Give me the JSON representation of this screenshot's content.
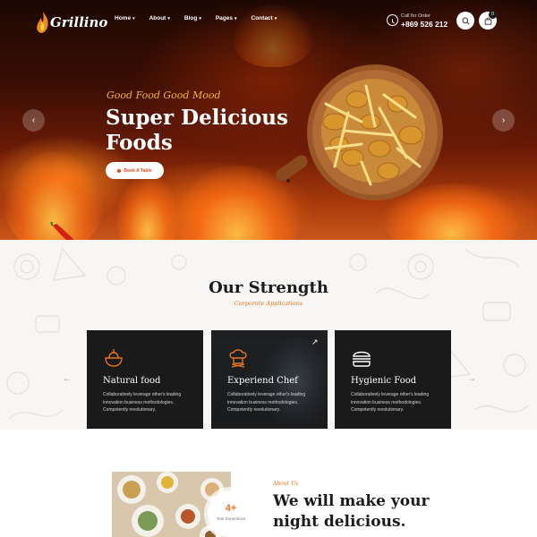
{
  "header": {
    "logo_text": "Grillino",
    "nav": [
      {
        "label": "Home"
      },
      {
        "label": "About"
      },
      {
        "label": "Blog"
      },
      {
        "label": "Pages"
      },
      {
        "label": "Contact"
      }
    ],
    "call_label": "Call for Order",
    "call_number": "+869 526 212",
    "cart_count": "0"
  },
  "hero": {
    "tagline": "Good Food Good Mood",
    "headline": "Super Delicious Foods",
    "button_label": "Book A Table"
  },
  "strength": {
    "title": "Our Strength",
    "subtitle": "Corporate Applications",
    "cards": [
      {
        "title": "Natural food",
        "description": "Collaboratively leverage other's leading innovation business methodologies. Competently revolutionary.",
        "icon": "natural-food-icon"
      },
      {
        "title": "Experiend Chef",
        "description": "Collaboratively leverage other's leading innovation business methodologies. Competently revolutionary.",
        "icon": "chef-icon"
      },
      {
        "title": "Hygienic Food",
        "description": "Collaboratively leverage other's leading innovation business methodologies. Competently revolutionary.",
        "icon": "burger-icon"
      }
    ]
  },
  "about": {
    "kicker": "About Us",
    "title": "We will make your night delicious.",
    "experience_value": "4+",
    "experience_label": "Year Experience"
  },
  "colors": {
    "accent": "#e7741f",
    "cta_text": "#e44b1a",
    "dark_card": "#1a1a1a",
    "tagline": "#f2b42a"
  }
}
